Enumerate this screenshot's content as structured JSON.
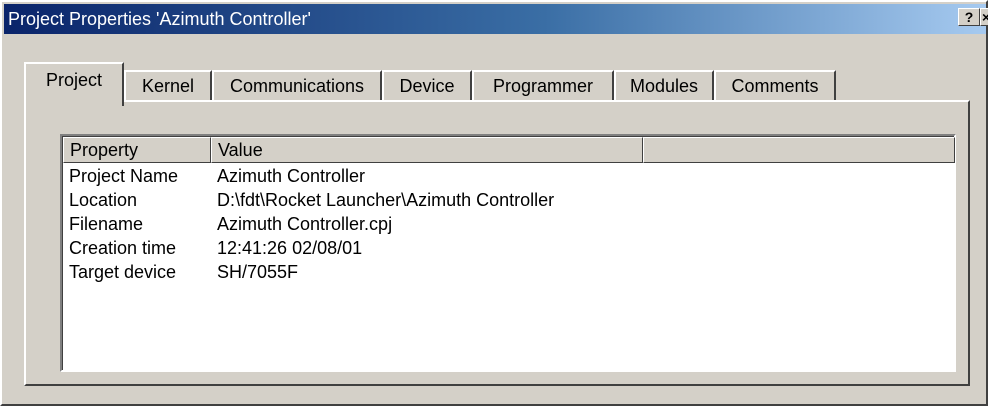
{
  "window": {
    "title": "Project Properties 'Azimuth Controller'",
    "help_label": "?",
    "close_label": "×"
  },
  "tabs": [
    {
      "label": "Project",
      "active": true
    },
    {
      "label": "Kernel",
      "active": false
    },
    {
      "label": "Communications",
      "active": false
    },
    {
      "label": "Device",
      "active": false
    },
    {
      "label": "Programmer",
      "active": false
    },
    {
      "label": "Modules",
      "active": false
    },
    {
      "label": "Comments",
      "active": false
    }
  ],
  "table": {
    "columns": [
      "Property",
      "Value",
      ""
    ],
    "rows": [
      {
        "property": "Project Name",
        "value": "Azimuth Controller"
      },
      {
        "property": "Location",
        "value": "D:\\fdt\\Rocket Launcher\\Azimuth Controller"
      },
      {
        "property": "Filename",
        "value": "Azimuth Controller.cpj"
      },
      {
        "property": "Creation time",
        "value": "12:41:26   02/08/01"
      },
      {
        "property": "Target device",
        "value": "SH/7055F"
      }
    ]
  },
  "colors": {
    "titlebar_start": "#0a246a",
    "titlebar_end": "#a6caf0",
    "face": "#d4d0c8"
  }
}
